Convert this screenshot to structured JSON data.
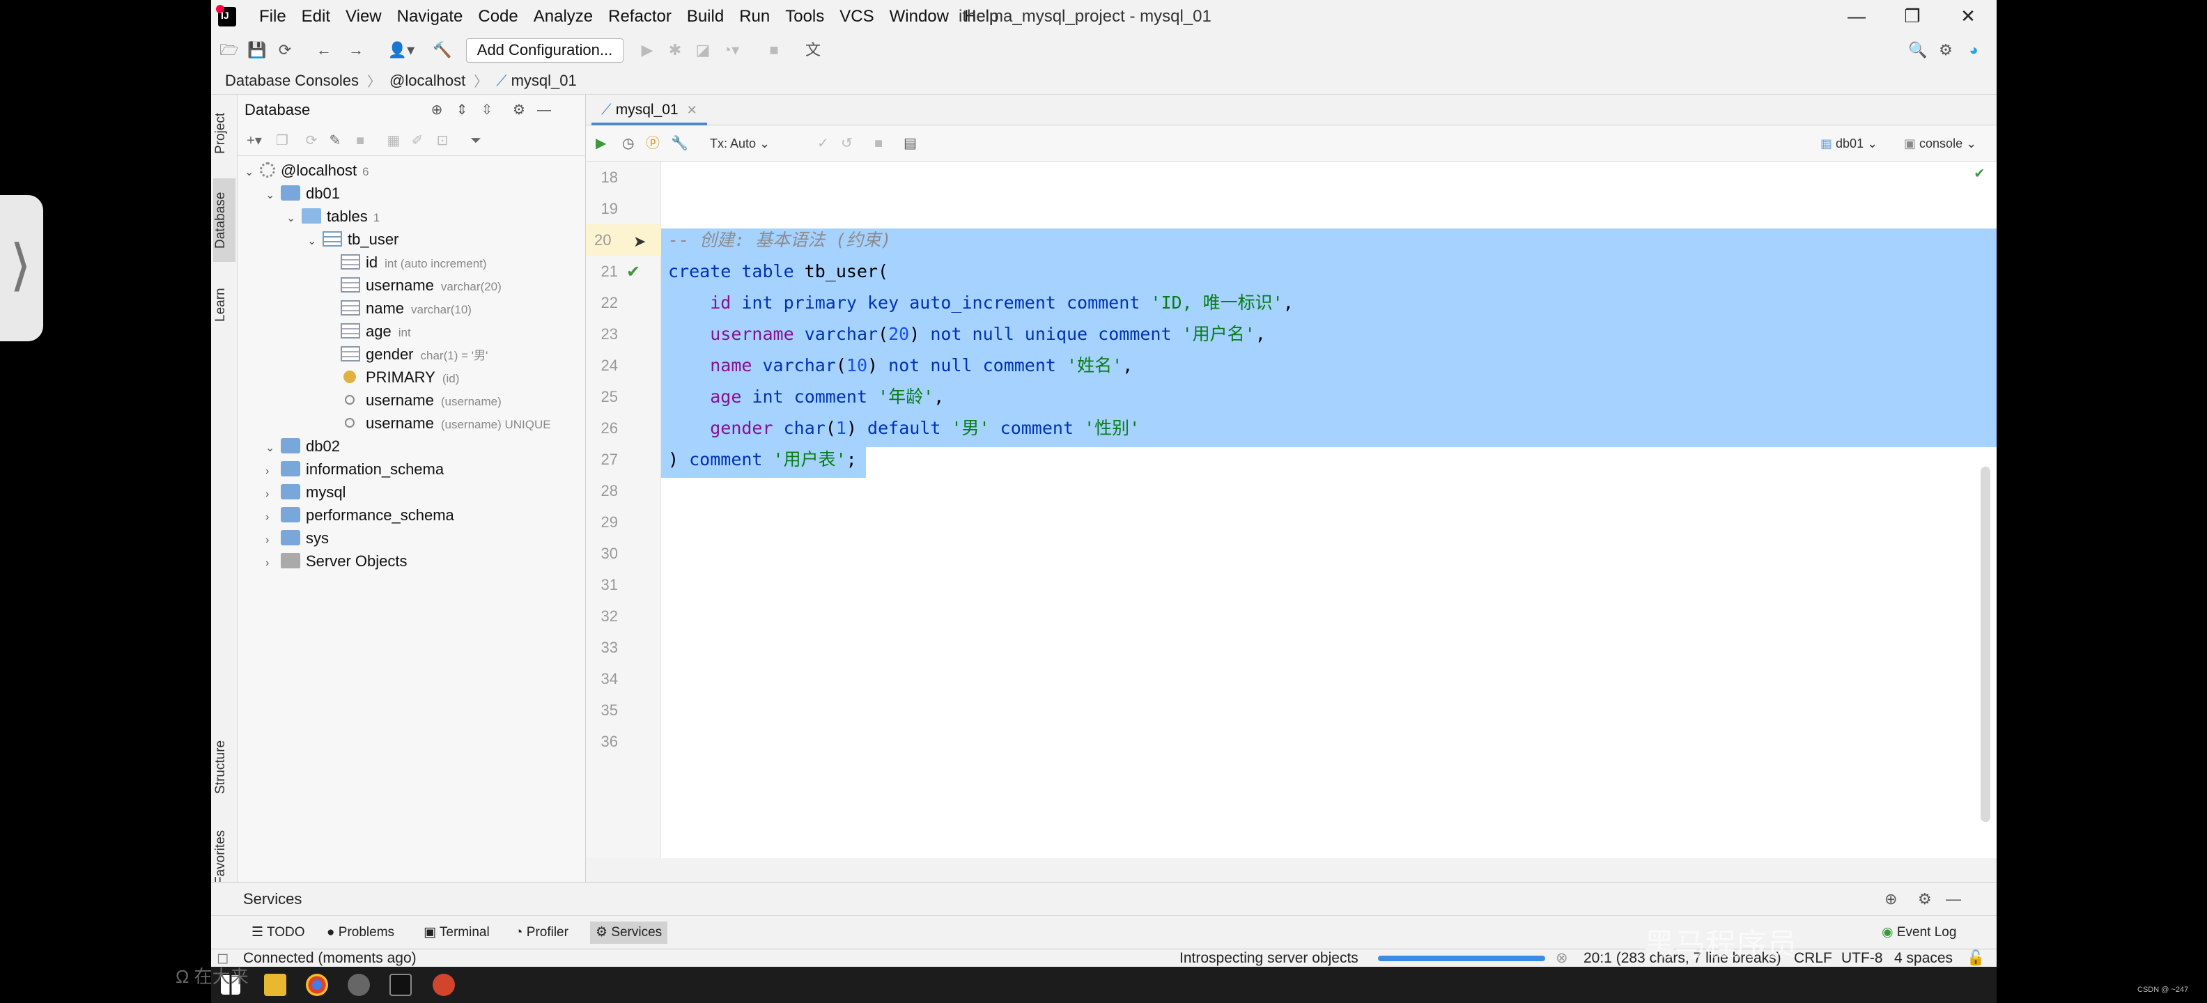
{
  "window": {
    "title": "itheima_mysql_project - mysql_01",
    "menu": [
      "File",
      "Edit",
      "View",
      "Navigate",
      "Code",
      "Analyze",
      "Refactor",
      "Build",
      "Run",
      "Tools",
      "VCS",
      "Window",
      "Help"
    ]
  },
  "toolbar": {
    "add_config": "Add Configuration..."
  },
  "breadcrumb": [
    "Database Consoles",
    "@localhost",
    "mysql_01"
  ],
  "tool_strip": {
    "project": "Project",
    "database": "Database",
    "learn": "Learn",
    "structure": "Structure",
    "favorites": "Favorites"
  },
  "db_panel": {
    "title": "Database",
    "tree": {
      "host": {
        "label": "@localhost",
        "count": "6"
      },
      "db01": "db01",
      "tables": {
        "label": "tables",
        "count": "1"
      },
      "tb_user": "tb_user",
      "columns": [
        {
          "name": "id",
          "meta": "int (auto increment)"
        },
        {
          "name": "username",
          "meta": "varchar(20)"
        },
        {
          "name": "name",
          "meta": "varchar(10)"
        },
        {
          "name": "age",
          "meta": "int"
        },
        {
          "name": "gender",
          "meta": "char(1) = '男'"
        }
      ],
      "keys": [
        {
          "name": "PRIMARY",
          "meta": "(id)"
        },
        {
          "name": "username",
          "meta": "(username)"
        },
        {
          "name": "username",
          "meta": "(username) UNIQUE"
        }
      ],
      "other": [
        "db02",
        "information_schema",
        "mysql",
        "performance_schema",
        "sys",
        "Server Objects"
      ]
    }
  },
  "editor": {
    "tab": "mysql_01",
    "tx": "Tx: Auto",
    "db_selector": "db01",
    "console_selector": "console",
    "line_numbers": [
      "18",
      "19",
      "20",
      "21",
      "22",
      "23",
      "24",
      "25",
      "26",
      "27",
      "28",
      "29",
      "30",
      "31",
      "32",
      "33",
      "34",
      "35",
      "36"
    ],
    "code": {
      "l20": "-- 创建: 基本语法 (约束)",
      "l21": "create table tb_user(",
      "l22": "    id int primary key auto_increment comment 'ID, 唯一标识',",
      "l23": "    username varchar(20) not null unique comment '用户名',",
      "l24": "    name varchar(10) not null comment '姓名',",
      "l25": "    age int comment '年龄',",
      "l26": "    gender char(1) default '男' comment '性别'",
      "l27": ") comment '用户表';"
    }
  },
  "services": {
    "title": "Services"
  },
  "bottom_tabs": [
    "TODO",
    "Problems",
    "Terminal",
    "Profiler",
    "Services",
    "Event Log"
  ],
  "status": {
    "connection": "Connected (moments ago)",
    "task": "Introspecting server objects",
    "progress": 1.0,
    "position": "20:1 (283 chars, 7 line breaks)",
    "line_sep": "CRLF",
    "encoding": "UTF-8",
    "indent": "4 spaces"
  },
  "overlay": {
    "left_watermark": "Ω 在大来",
    "center_watermark": "黑马程序员",
    "corner": "CSDN @ ~247"
  }
}
